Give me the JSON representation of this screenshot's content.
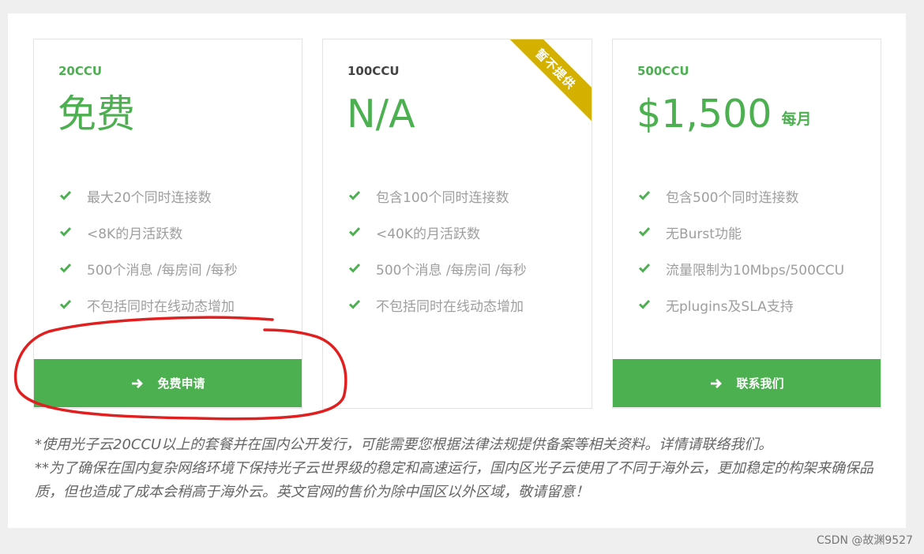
{
  "plans": [
    {
      "tier": "20CCU",
      "price": "免费",
      "price_unit": "",
      "features": [
        "最大20个同时连接数",
        "<8K的月活跃数",
        "500个消息 /每房间 /每秒",
        "不包括同时在线动态增加"
      ],
      "button_label": "免费申请"
    },
    {
      "tier": "100CCU",
      "price": "N/A",
      "ribbon": "暂不提供",
      "features": [
        "包含100个同时连接数",
        "<40K的月活跃数",
        "500个消息 /每房间 /每秒",
        "不包括同时在线动态增加"
      ]
    },
    {
      "tier": "500CCU",
      "price": "$1,500",
      "price_unit": "每月",
      "features": [
        "包含500个同时连接数",
        "无Burst功能",
        "流量限制为10Mbps/500CCU",
        "无plugins及SLA支持"
      ],
      "button_label": "联系我们"
    }
  ],
  "notes": {
    "line1": "*使用光子云20CCU以上的套餐并在国内公开发行，可能需要您根据法律法规提供备案等相关资料。详情请联络我们。",
    "line2": "**为了确保在国内复杂网络环境下保持光子云世界级的稳定和高速运行，国内区光子云使用了不同于海外云，更加稳定的构架来确保品质，但也造成了成本会稍高于海外云。英文官网的售价为除中国区以外区域，敬请留意！"
  },
  "watermark": "CSDN @故渊9527",
  "colors": {
    "accent": "#4caf50",
    "ribbon": "#d4b000",
    "annotation": "#e02020"
  },
  "icons": {
    "feature": "check-icon",
    "button": "arrow-right-icon"
  }
}
